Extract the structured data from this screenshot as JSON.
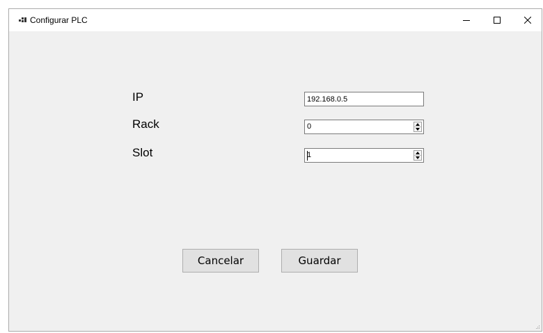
{
  "window": {
    "title": "Configurar PLC",
    "icon": "winforms-app-icon",
    "controls": {
      "minimize": "minimize-icon",
      "maximize": "maximize-icon",
      "close": "close-icon"
    }
  },
  "form": {
    "ip_label": "IP",
    "ip_value": "192.168.0.5",
    "rack_label": "Rack",
    "rack_value": "0",
    "slot_label": "Slot",
    "slot_value": "1"
  },
  "buttons": {
    "cancel_label": "Cancelar",
    "save_label": "Guardar"
  },
  "colors": {
    "window_background": "#f0f0f0",
    "titlebar_background": "#ffffff",
    "button_background": "#e1e1e1",
    "input_border": "#7a7a7a"
  }
}
